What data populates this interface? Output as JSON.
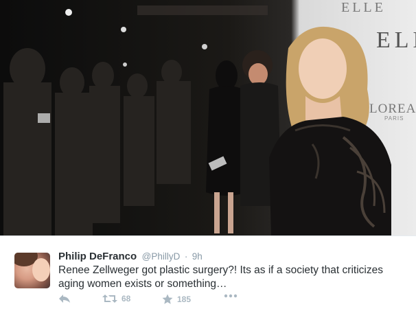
{
  "tweet": {
    "author_name": "Philip DeFranco",
    "author_handle": "@PhillyD",
    "separator": "·",
    "timestamp": "9h",
    "text": "Renee Zellweger got plastic surgery?!  Its as if a society that criticizes aging women exists or something…",
    "retweet_count": "68",
    "favorite_count": "185"
  },
  "photo": {
    "backdrop_logo_top": "ELLE",
    "backdrop_logo_main": "ELLE",
    "backdrop_sponsor": "LOREAL",
    "backdrop_sponsor_sub": "PARIS"
  },
  "icons": {
    "reply": "reply-icon",
    "retweet": "retweet-icon",
    "favorite": "star-icon",
    "more": "more-icon"
  },
  "colors": {
    "text_primary": "#292f33",
    "text_secondary": "#8899a6",
    "action_gray": "#aab8c2"
  }
}
